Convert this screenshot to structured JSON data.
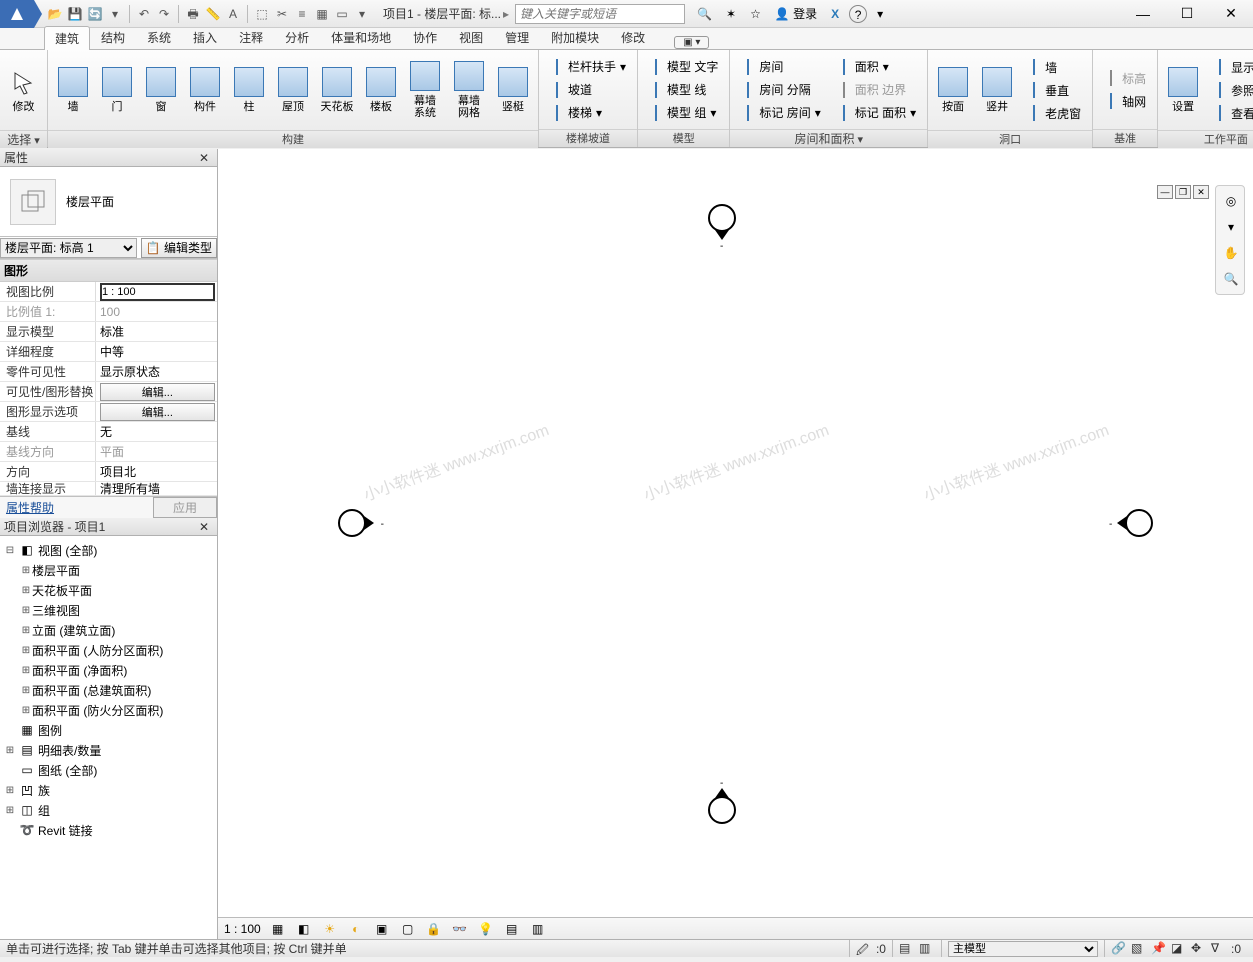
{
  "title": "项目1 - 楼层平面: 标...",
  "search_placeholder": "键入关键字或短语",
  "login_label": "登录",
  "tabs": [
    "建筑",
    "结构",
    "系统",
    "插入",
    "注释",
    "分析",
    "体量和场地",
    "协作",
    "视图",
    "管理",
    "附加模块",
    "修改"
  ],
  "active_tab": "建筑",
  "ribbon": {
    "select": {
      "modify": "修改",
      "panel": "选择"
    },
    "build": {
      "panel": "构建",
      "wall": "墙",
      "door": "门",
      "window": "窗",
      "component": "构件",
      "column": "柱",
      "roof": "屋顶",
      "ceiling": "天花板",
      "floor": "楼板",
      "curtain_system": "幕墙\n系统",
      "curtain_grid": "幕墙\n网格",
      "mullion": "竖梃"
    },
    "circulation": {
      "panel": "楼梯坡道",
      "railing": "栏杆扶手",
      "ramp": "坡道",
      "stair": "楼梯"
    },
    "model": {
      "panel": "模型",
      "model_text": "模型 文字",
      "model_line": "模型 线",
      "model_group": "模型 组"
    },
    "room": {
      "panel": "房间和面积",
      "room": "房间",
      "separator": "房间 分隔",
      "tag_room": "标记 房间",
      "area": "面积",
      "area_boundary": "面积 边界",
      "tag_area": "标记 面积"
    },
    "opening": {
      "panel": "洞口",
      "by_face": "按面",
      "shaft": "竖井",
      "wall": "墙",
      "vertical": "垂直",
      "dormer": "老虎窗"
    },
    "datum": {
      "panel": "基准",
      "level": "标高",
      "grid": "轴网"
    },
    "workplane": {
      "panel": "工作平面",
      "set": "设置",
      "show": "显示",
      "ref": "参照 平面",
      "viewer": "查看器"
    }
  },
  "properties": {
    "title": "属性",
    "type_name": "楼层平面",
    "instance": "楼层平面: 标高 1",
    "edit_type": "编辑类型",
    "section": "图形",
    "rows": {
      "view_scale": {
        "k": "视图比例",
        "v": "1 : 100"
      },
      "scale_value": {
        "k": "比例值 1:",
        "v": "100"
      },
      "display_model": {
        "k": "显示模型",
        "v": "标准"
      },
      "detail_level": {
        "k": "详细程度",
        "v": "中等"
      },
      "parts_vis": {
        "k": "零件可见性",
        "v": "显示原状态"
      },
      "vis_override": {
        "k": "可见性/图形替换",
        "v": "编辑..."
      },
      "graphic_opts": {
        "k": "图形显示选项",
        "v": "编辑..."
      },
      "underlay": {
        "k": "基线",
        "v": "无"
      },
      "underlay_orient": {
        "k": "基线方向",
        "v": "平面"
      },
      "orientation": {
        "k": "方向",
        "v": "项目北"
      },
      "wall_join": {
        "k": "墙连接显示",
        "v": "清理所有墙"
      }
    },
    "help": "属性帮助",
    "apply": "应用"
  },
  "browser": {
    "title": "项目浏览器 - 项目1",
    "views_root": "视图 (全部)",
    "nodes": [
      "楼层平面",
      "天花板平面",
      "三维视图",
      "立面 (建筑立面)",
      "面积平面 (人防分区面积)",
      "面积平面 (净面积)",
      "面积平面 (总建筑面积)",
      "面积平面 (防火分区面积)"
    ],
    "legends": "图例",
    "schedules": "明细表/数量",
    "sheets": "图纸 (全部)",
    "families": "族",
    "groups": "组",
    "links": "Revit 链接"
  },
  "view_status": {
    "scale": "1 : 100"
  },
  "statusbar": {
    "hint": "单击可进行选择; 按 Tab 键并单击可选择其他项目; 按 Ctrl 键并单",
    "sel_count": ":0",
    "design_option": "主模型",
    "filter_count": ":0"
  },
  "watermark": "小小软件迷 www.xxrjm.com"
}
